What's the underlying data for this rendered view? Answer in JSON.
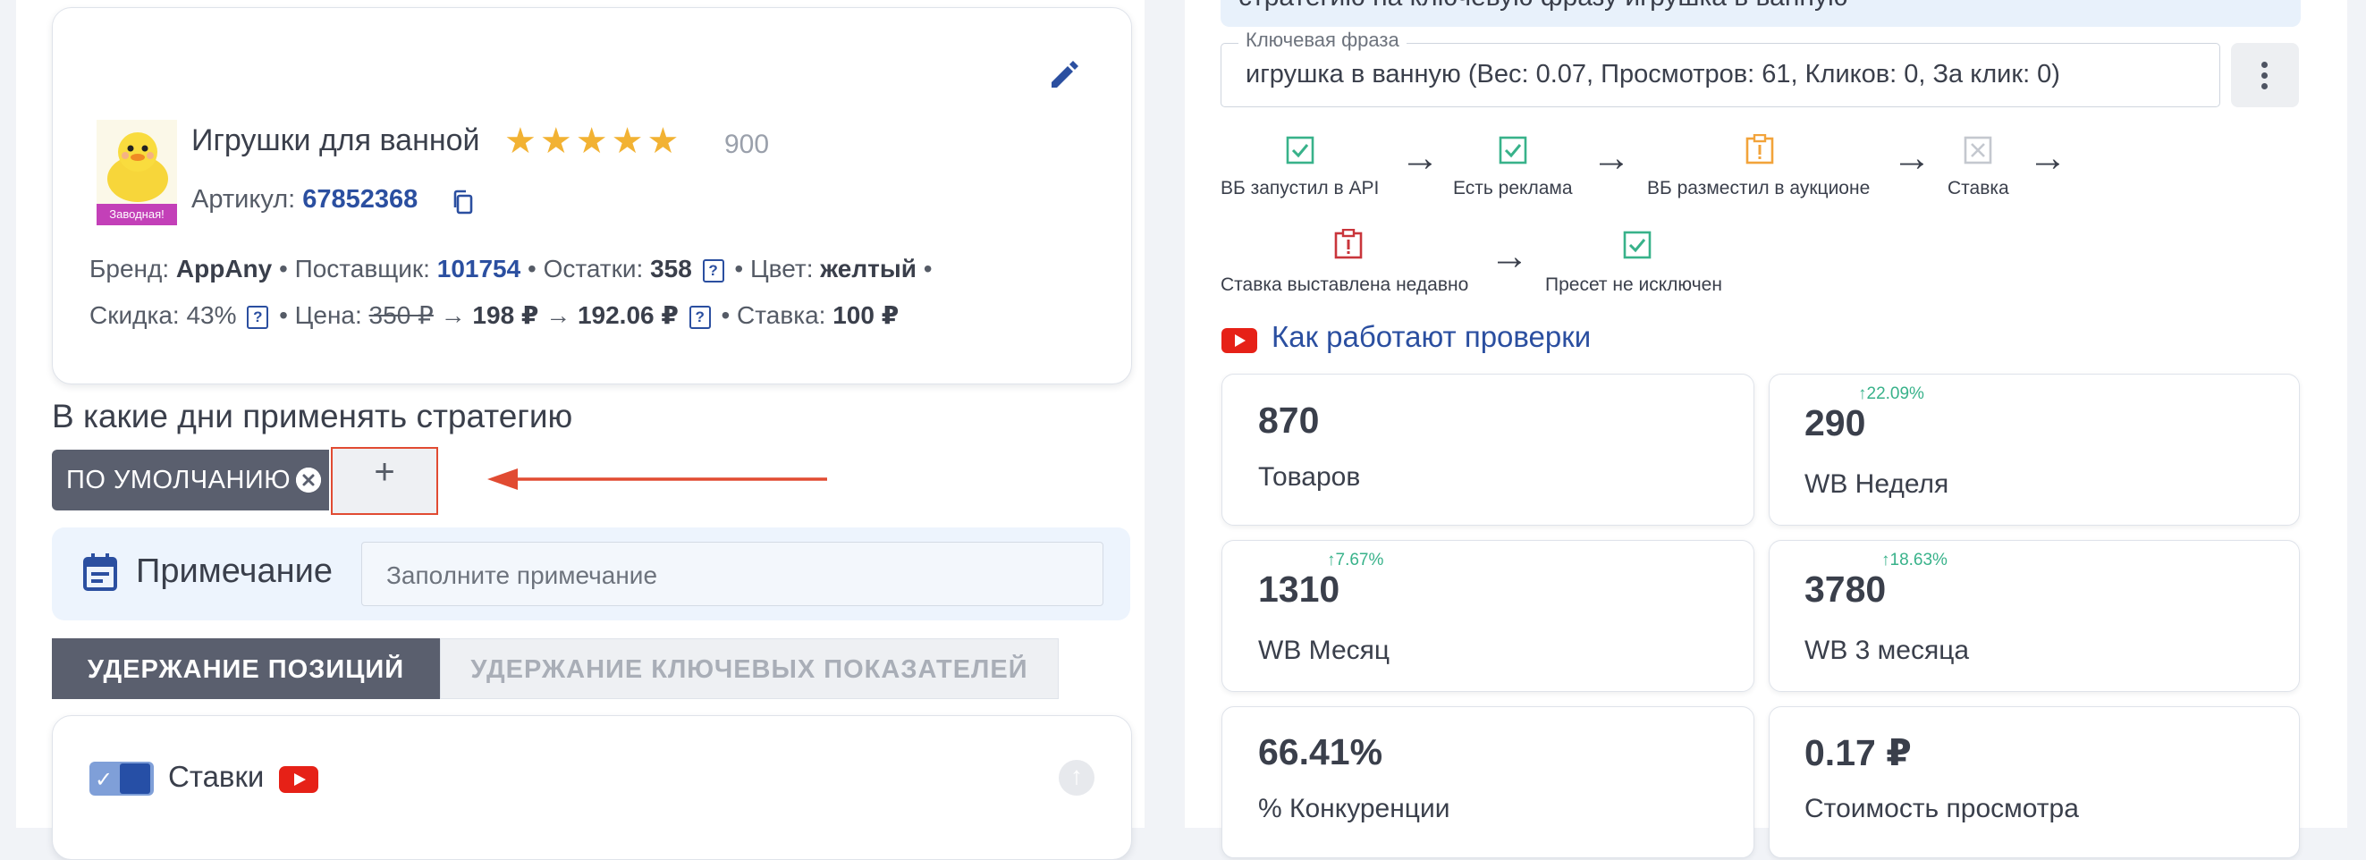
{
  "product": {
    "name": "Игрушки для ванной",
    "stars": 5,
    "rating_count": "900",
    "thumb_badge": "Заводная!",
    "sku_label": "Артикул:",
    "sku": "67852368",
    "meta_line1": {
      "brand_label": "Бренд:",
      "brand": "AppAny",
      "supplier_label": "Поставщик:",
      "supplier": "101754",
      "stock_label": "Остатки:",
      "stock": "358",
      "color_label": "Цвет:",
      "color": "желтый"
    },
    "meta_line2": {
      "discount_label": "Скидка:",
      "discount": "43%",
      "price_label": "Цена:",
      "price_old": "350 ₽",
      "price_mid": "198 ₽",
      "price_new": "192.06 ₽",
      "bid_label": "Ставка:",
      "bid": "100 ₽"
    },
    "help_glyph": "?",
    "bullet": "•",
    "arrow_glyph": "→"
  },
  "schedule": {
    "title": "В какие дни применять стратегию",
    "chip_label": "ПО УМОЛЧАНИЮ",
    "add_label": "+"
  },
  "note": {
    "label": "Примечание",
    "placeholder": "Заполните примечание"
  },
  "tabs": [
    {
      "label": "УДЕРЖАНИЕ ПОЗИЦИЙ",
      "active": true
    },
    {
      "label": "УДЕРЖАНИЕ КЛЮЧЕВЫХ ПОКАЗАТЕЛЕЙ",
      "active": false
    }
  ],
  "bids": {
    "label": "Ставки",
    "toggle_on": true
  },
  "right": {
    "banner_text": "стратегию на ключевую фразу игрушка в ванную",
    "key_phrase_legend": "Ключевая фраза",
    "key_phrase_value": "игрушка в ванную (Вес: 0.07, Просмотров: 61, Кликов: 0, За клик: 0)",
    "checks_row1": [
      {
        "label": "ВБ запустил в API",
        "status": "ok"
      },
      {
        "label": "Есть реклама",
        "status": "ok"
      },
      {
        "label": "ВБ разместил в аукционе",
        "status": "warn"
      },
      {
        "label": "Ставка",
        "status": "off"
      }
    ],
    "checks_row2": [
      {
        "label": "Ставка выставлена недавно",
        "status": "error"
      },
      {
        "label": "Пресет не исключен",
        "status": "ok"
      }
    ],
    "how_link": "Как работают проверки",
    "stats": [
      {
        "value": "870",
        "label": "Товаров",
        "delta": ""
      },
      {
        "value": "290",
        "label": "WB Неделя",
        "delta": "↑22.09%"
      },
      {
        "value": "1310",
        "label": "WB Месяц",
        "delta": "↑7.67%"
      },
      {
        "value": "3780",
        "label": "WB 3 месяца",
        "delta": "↑18.63%"
      },
      {
        "value": "66.41%",
        "label": "% Конкуренции",
        "delta": ""
      },
      {
        "value": "0.17 ₽",
        "label": "Стоимость просмотра",
        "delta": ""
      }
    ]
  },
  "colors": {
    "accent_blue": "#2b4fa0",
    "star": "#f2b233",
    "highlight_red": "#e14b32",
    "ok_green": "#38b28a",
    "warn_orange": "#f2a33a",
    "error_red": "#c9353b",
    "youtube_red": "#e62117"
  }
}
